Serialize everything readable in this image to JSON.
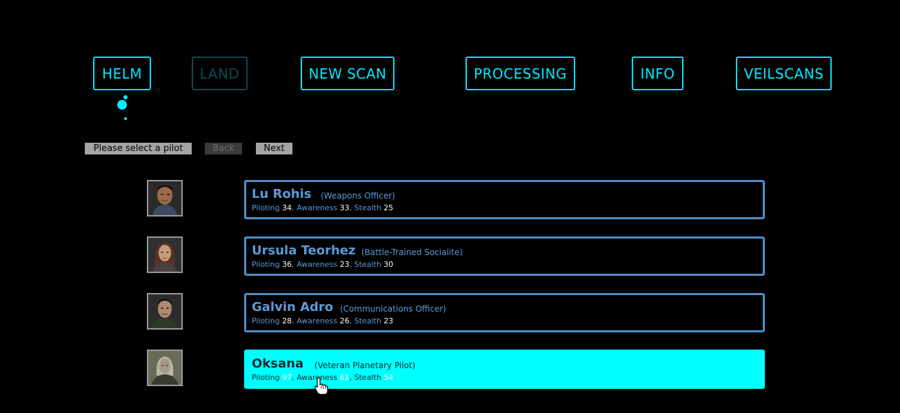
{
  "nav": {
    "helm": "HELM",
    "land": "LAND",
    "new_scan": "NEW SCAN",
    "processing": "PROCESSING",
    "info": "INFO",
    "veilscans": "VEILSCANS"
  },
  "controls": {
    "prompt": "Please select a pilot",
    "back": "Back",
    "next": "Next"
  },
  "stat_labels": {
    "piloting": "Piloting",
    "awareness": "Awareness",
    "stealth": "Stealth"
  },
  "pilots": [
    {
      "name": "Lu Rohis",
      "role": "(Weapons Officer)",
      "piloting": "34",
      "awareness": "33",
      "stealth": "25"
    },
    {
      "name": "Ursula Teorhez",
      "role": "(Battle-Trained Socialite)",
      "piloting": "36",
      "awareness": "23",
      "stealth": "30"
    },
    {
      "name": "Galvin Adro",
      "role": "(Communications Officer)",
      "piloting": "28",
      "awareness": "26",
      "stealth": "23"
    },
    {
      "name": "Oksana",
      "role": "(Veteran Planetary Pilot)",
      "piloting": "97",
      "awareness": "61",
      "stealth": "54"
    }
  ],
  "colors": {
    "accent": "#00eaff",
    "card_border": "#4f8fc9",
    "selected": "#00ffff"
  }
}
